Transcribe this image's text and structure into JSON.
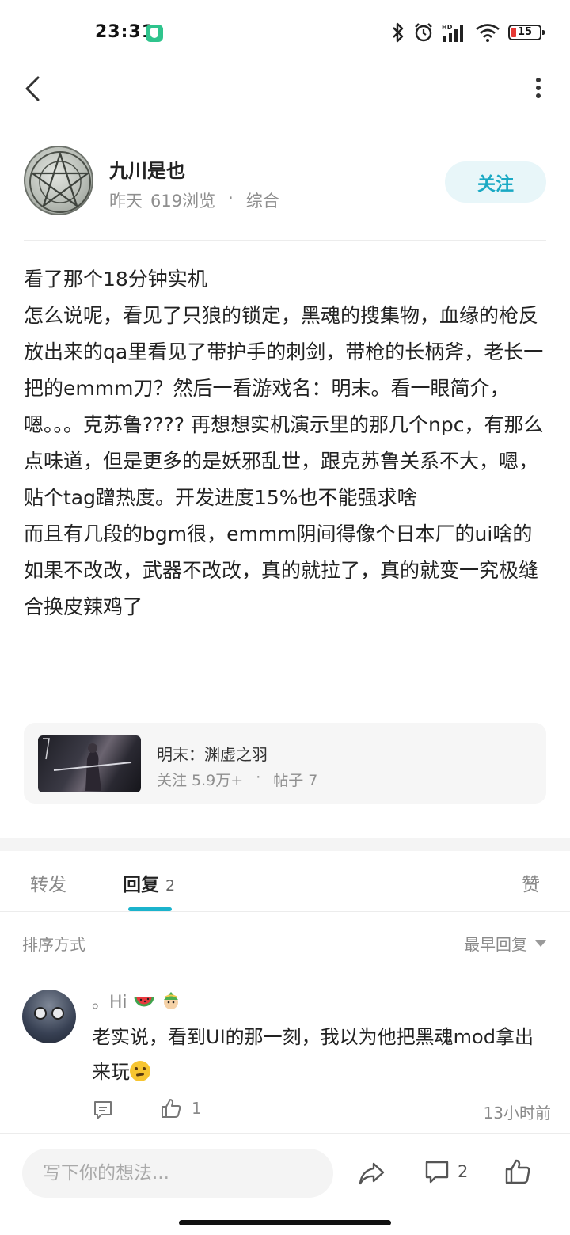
{
  "status_bar": {
    "time": "23:31",
    "battery": "15"
  },
  "post": {
    "author": {
      "name": "九川是也",
      "date": "昨天",
      "views": "619浏览",
      "separator": "·",
      "category": "综合"
    },
    "follow_label": "关注",
    "body_lines": [
      "看了那个18分钟实机",
      "怎么说呢，看见了只狼的锁定，黑魂的搜集物，血缘的枪反",
      "放出来的qa里看见了带护手的刺剑，带枪的长柄斧，老长一把的emmm刀？然后一看游戏名：明末。看一眼简介，嗯。。。克苏鲁???? 再想想实机演示里的那几个npc，有那么点味道，但是更多的是妖邪乱世，跟克苏鲁关系不大，嗯，贴个tag蹭热度。开发进度15%也不能强求啥",
      "而且有几段的bgm很，emmm阴间得像个日本厂的ui啥的如果不改改，武器不改改，真的就拉了，真的就变一究极缝合换皮辣鸡了"
    ]
  },
  "topic": {
    "name": "明末：渊虚之羽",
    "followers": "关注 5.9万+",
    "separator": "·",
    "posts": "帖子 7"
  },
  "tabs": {
    "forward": "转发",
    "replies": "回复",
    "replies_count": "2",
    "like": "赞"
  },
  "sort": {
    "label": "排序方式",
    "selected": "最早回复"
  },
  "comments": [
    {
      "user": "。Hi",
      "text": "老实说，看到UI的那一刻，我以为他把黑魂mod拿出来玩",
      "likes": "1",
      "time": "13小时前"
    }
  ],
  "bottom_bar": {
    "placeholder": "写下你的想法...",
    "comment_count": "2"
  },
  "colors": {
    "accent": "#1bb3cc",
    "follow_bg": "#e8f6f9",
    "muted_text": "#8f8f8f"
  }
}
